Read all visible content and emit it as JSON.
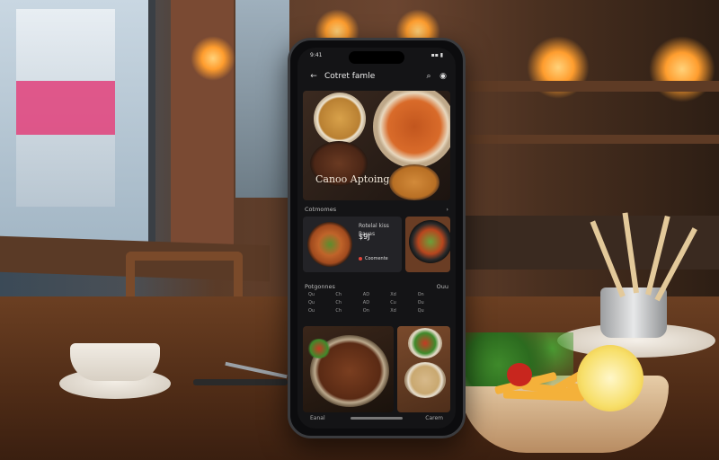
{
  "phone": {
    "status_time": "9:41",
    "status_icons": "▪▪ ▮",
    "header_title": "Cotret famle",
    "icons": [
      "back-arrow-icon",
      "search-icon",
      "profile-icon"
    ],
    "hero_title": "Canoo Aptoing",
    "section1_label": "Cotmomes",
    "section1_action": "›",
    "card1": {
      "name": "Rotelal kiss",
      "subtitle": "Ravas",
      "price": "$9J",
      "badge": "Coomente"
    },
    "section2_label": "Potgonnes",
    "section2_action": "Ouu",
    "info_grid": [
      "Qu",
      "Ch",
      "AD",
      "Xd",
      "On",
      "Qu",
      "Ch",
      "AD",
      "Cu",
      "Ou",
      "Ou",
      "Ch",
      "On",
      "Xd",
      "Qu"
    ],
    "bottom_left": "Eanal",
    "bottom_right": "Carem"
  }
}
